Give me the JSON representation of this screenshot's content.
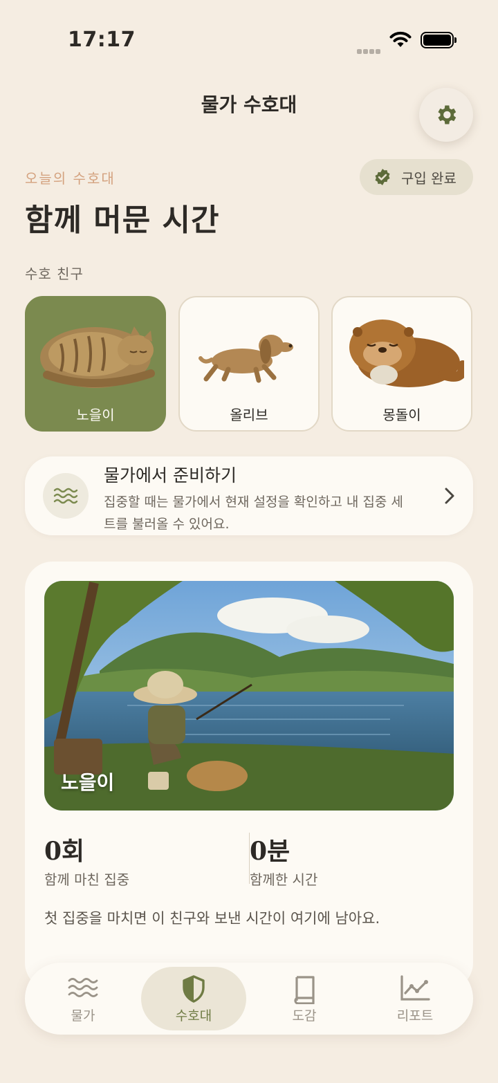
{
  "status_bar": {
    "time": "17:17"
  },
  "header": {
    "title": "물가 수호대"
  },
  "settings": {
    "icon": "gear-icon"
  },
  "section": {
    "subtitle": "오늘의 수호대",
    "badge": "구입 완료",
    "title": "함께 머문 시간",
    "friends_label": "수호 친구"
  },
  "friends": [
    {
      "name": "노을이",
      "selected": true
    },
    {
      "name": "올리브",
      "selected": false
    },
    {
      "name": "몽돌이",
      "selected": false
    }
  ],
  "prep": {
    "title": "물가에서 준비하기",
    "desc": "집중할 때는 물가에서 현재 설정을 확인하고 내 집중 세트를 불러올 수 있어요."
  },
  "main": {
    "scene_label": "노을이",
    "stats": [
      {
        "value": "0회",
        "label": "함께 마친 집중"
      },
      {
        "value": "0분",
        "label": "함께한 시간"
      }
    ],
    "hint": "첫 집중을 마치면 이 친구와 보낸 시간이 여기에 남아요."
  },
  "tabs": [
    {
      "label": "물가",
      "icon": "waves-icon"
    },
    {
      "label": "수호대",
      "icon": "shield-icon",
      "active": true
    },
    {
      "label": "도감",
      "icon": "book-icon"
    },
    {
      "label": "리포트",
      "icon": "chart-icon"
    }
  ],
  "colors": {
    "accent": "#7b8a4f",
    "background": "#f5ede2",
    "card": "#fdfaf4",
    "subtitle": "#d4a27f"
  }
}
